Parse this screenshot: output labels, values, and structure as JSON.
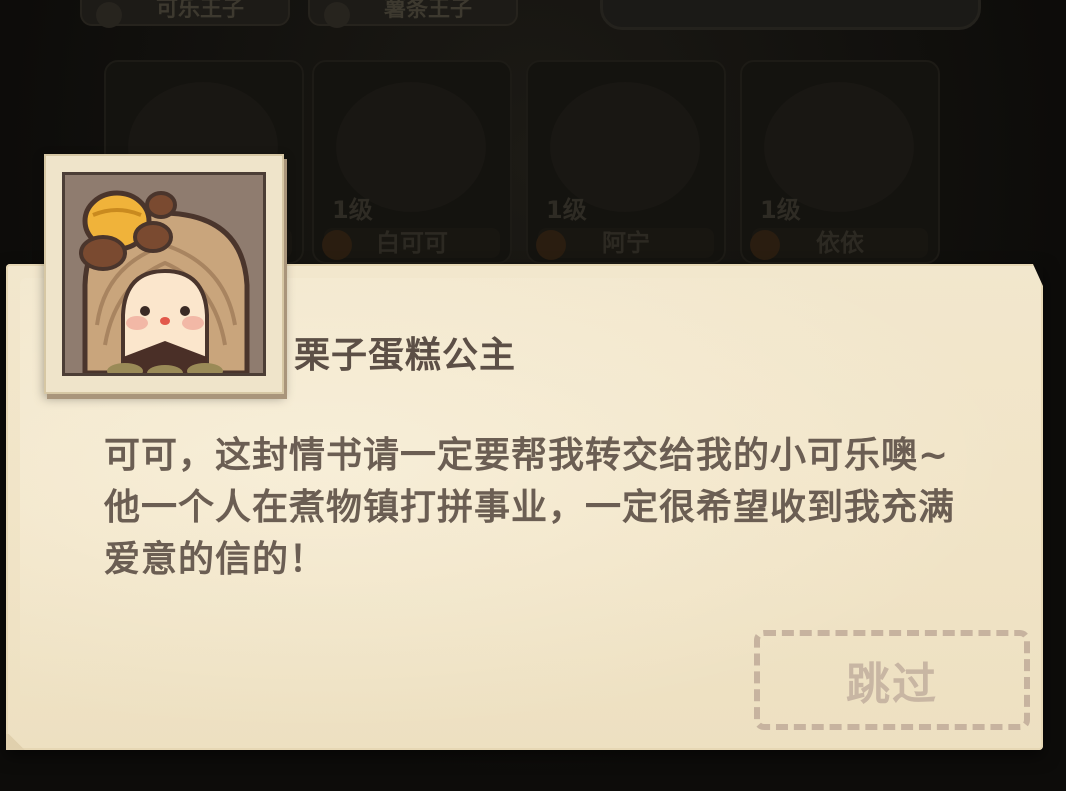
{
  "background": {
    "tabs": [
      "可乐王子",
      "薯条王子"
    ],
    "cards": [
      {
        "level": "",
        "name": ""
      },
      {
        "level": "1级",
        "name": "白可可"
      },
      {
        "level": "1级",
        "name": "阿宁"
      },
      {
        "level": "1级",
        "name": "依依"
      }
    ]
  },
  "dialog": {
    "speaker": "栗子蛋糕公主",
    "text": "可可，这封情书请一定要帮我转交给我的小可乐噢~他一个人在煮物镇打拼事业，一定很希望收到我充满爱意的信的！",
    "skip_label": "跳过"
  },
  "colors": {
    "paper": "#f2e7cd",
    "speaker_text": "#5c4f46",
    "dialog_text": "#6b5e53",
    "skip_border": "#c7b39f"
  },
  "icons": {
    "portrait": "chestnut-cake-princess-avatar"
  }
}
